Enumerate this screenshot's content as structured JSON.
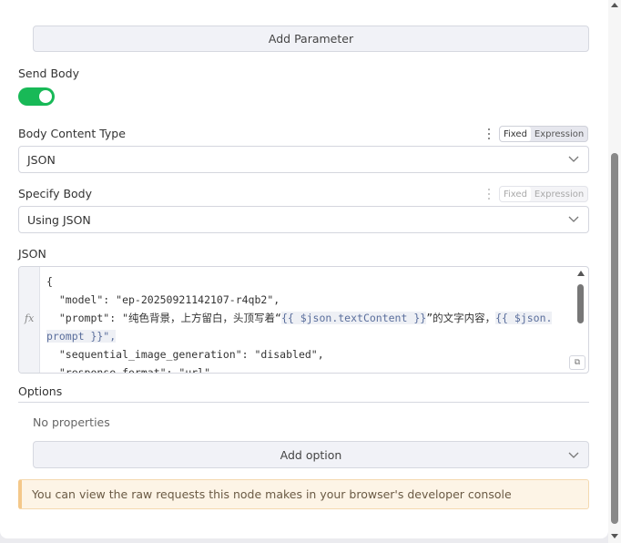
{
  "add_parameter_label": "Add Parameter",
  "send_body": {
    "label": "Send Body",
    "enabled": true
  },
  "body_content_type": {
    "label": "Body Content Type",
    "mode_fixed": "Fixed",
    "mode_expression": "Expression",
    "value": "JSON"
  },
  "specify_body": {
    "label": "Specify Body",
    "mode_fixed": "Fixed",
    "mode_expression": "Expression",
    "value": "Using JSON"
  },
  "json_field": {
    "label": "JSON",
    "fx_label": "fx",
    "lines": [
      "{",
      "  \"model\": \"ep-20250921142107-r4qb2\",",
      "  \"prompt\": \"纯色背景，上方留白，头顶写着“",
      "prompt }}\",",
      "  \"sequential_image_generation\": \"disabled\",",
      "  \"response_format\": \"url\","
    ],
    "prompt_expr_1": "{{ $json.textContent }}",
    "prompt_mid": "”的文字内容，",
    "prompt_expr_2_start": "{{ $json."
  },
  "options": {
    "title": "Options",
    "empty_text": "No properties",
    "add_option_label": "Add option"
  },
  "notice_text": "You can view the raw requests this node makes in your browser's developer console",
  "colors": {
    "toggle_on": "#18b957",
    "notice_bg": "#fdf4e6",
    "notice_border": "#f4c88a"
  }
}
